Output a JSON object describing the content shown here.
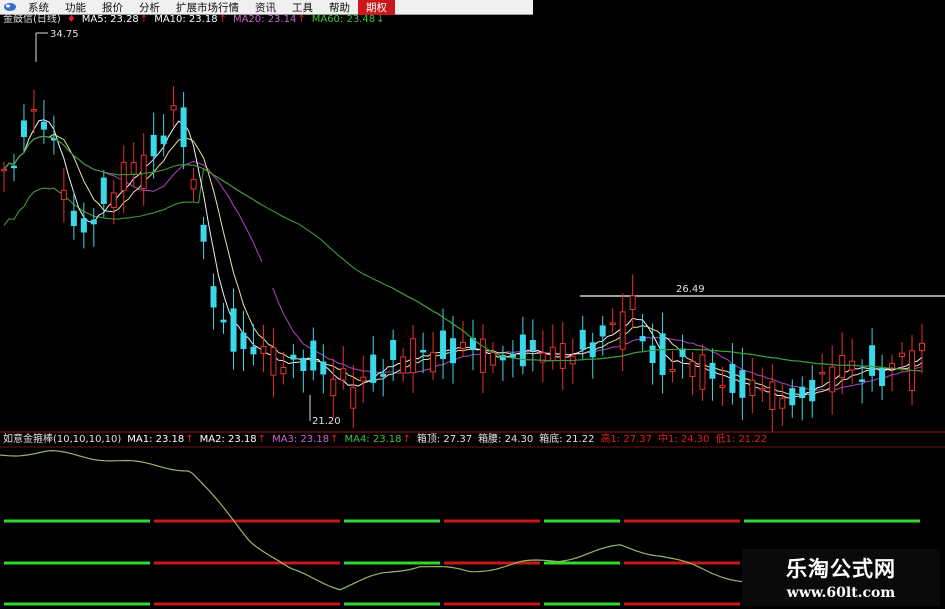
{
  "menu": {
    "items": [
      "系统",
      "功能",
      "报价",
      "分析",
      "扩展市场行情",
      "资讯",
      "工具",
      "帮助",
      "期权"
    ],
    "active_index": 8
  },
  "main_panel": {
    "title": "金鼓信(日线)",
    "indicators": [
      {
        "label": "MA5: 23.28",
        "color": "#ffffff",
        "arrow": "↑"
      },
      {
        "label": "MA10: 23.18",
        "color": "#ffffff",
        "arrow": "↑"
      },
      {
        "label": "MA20: 23.14",
        "color": "#d060d0",
        "arrow": "↑"
      },
      {
        "label": "MA60: 23.48",
        "color": "#40c040",
        "arrow": "↓"
      }
    ],
    "high_label": "34.75",
    "low_label": "21.20",
    "price_tag": "26.49"
  },
  "sub_panel": {
    "title": "如意金箍棒(10,10,10,10)",
    "indicators": [
      {
        "label": "MA1: 23.18",
        "color": "#ffffff",
        "arrow": "↑"
      },
      {
        "label": "MA2: 23.18",
        "color": "#ffffff",
        "arrow": "↑"
      },
      {
        "label": "MA3: 23.18",
        "color": "#d060d0",
        "arrow": "↑"
      },
      {
        "label": "MA4: 23.18",
        "color": "#40c040",
        "arrow": "↑"
      },
      {
        "label": "箱顶: 27.37",
        "color": "#e0e0e0",
        "arrow": ""
      },
      {
        "label": "箱腰: 24.30",
        "color": "#e0e0e0",
        "arrow": ""
      },
      {
        "label": "箱底: 21.22",
        "color": "#e0e0e0",
        "arrow": ""
      },
      {
        "label": "高1: 27.37",
        "color": "#e02020",
        "arrow": ""
      },
      {
        "label": "中1: 24.30",
        "color": "#e02020",
        "arrow": ""
      },
      {
        "label": "低1: 21.22",
        "color": "#e02020",
        "arrow": ""
      }
    ]
  },
  "watermark": {
    "title": "乐淘公式网",
    "url": "www.60lt.com"
  },
  "colors": {
    "up": "#e8302c",
    "down": "#3ad8e8",
    "ma_white": "#f0f0f0",
    "ma_yellow": "#e8e0a0",
    "ma_purple": "#a040b0",
    "ma_green": "#3c9a3c",
    "sub_line": "#9ab66a",
    "band_red": "#c81818",
    "band_green": "#30d830"
  }
}
